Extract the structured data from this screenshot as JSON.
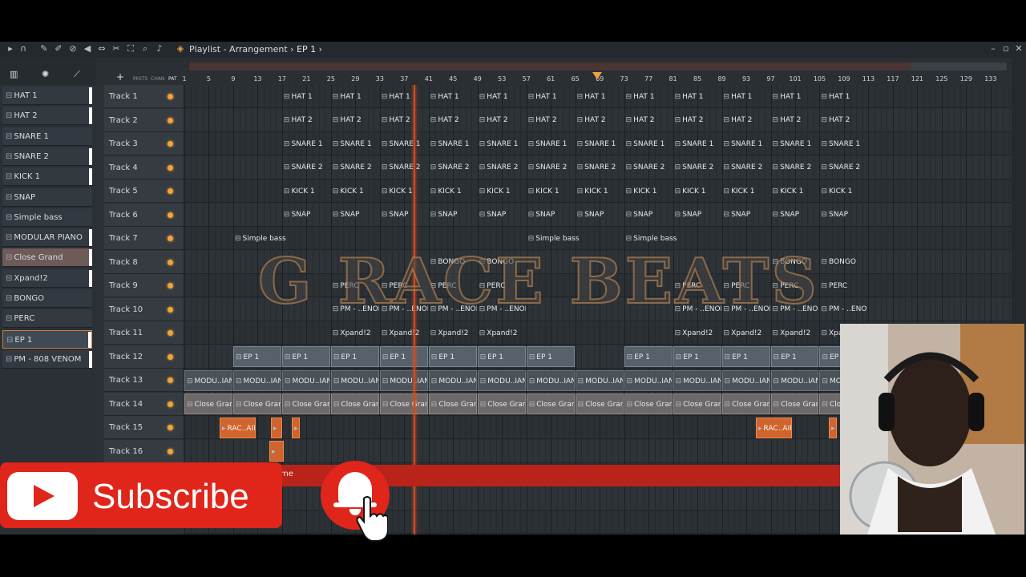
{
  "titlebar": {
    "app_title": "Playlist - Arrangement",
    "separator": "›",
    "pattern": "EP 1",
    "arrow": "›"
  },
  "browser": {
    "patterns": [
      {
        "label": "HAT 1",
        "bar": true
      },
      {
        "label": "HAT 2",
        "bar": true
      },
      {
        "label": "SNARE 1",
        "bar": false
      },
      {
        "label": "SNARE 2",
        "bar": true
      },
      {
        "label": "KICK 1",
        "bar": true
      },
      {
        "label": "SNAP",
        "bar": false
      },
      {
        "label": "Simple bass",
        "bar": false
      },
      {
        "label": "MODULAR PIANO",
        "bar": true
      },
      {
        "label": "Close Grand",
        "bar": true
      },
      {
        "label": "Xpand!2",
        "bar": true
      },
      {
        "label": "BONGO",
        "bar": false
      },
      {
        "label": "PERC",
        "bar": false
      },
      {
        "label": "EP 1",
        "bar": true
      },
      {
        "label": "PM - 808 VENOM",
        "bar": true
      }
    ]
  },
  "header": {
    "add_symbol": "+",
    "small_labels": [
      "MISTS",
      "CHAN",
      "PAT"
    ]
  },
  "tracks": [
    "Track 1",
    "Track 2",
    "Track 3",
    "Track 4",
    "Track 5",
    "Track 6",
    "Track 7",
    "Track 8",
    "Track 9",
    "Track 10",
    "Track 11",
    "Track 12",
    "Track 13",
    "Track 14",
    "Track 15",
    "Track 16"
  ],
  "ruler": {
    "bars": [
      "1",
      "5",
      "9",
      "13",
      "17",
      "21",
      "25",
      "29",
      "33",
      "37",
      "41",
      "45",
      "49",
      "53",
      "57",
      "61",
      "65",
      "69",
      "73",
      "77",
      "81",
      "85",
      "89",
      "93",
      "97",
      "101",
      "105",
      "109",
      "113",
      "117",
      "121",
      "125",
      "129",
      "133"
    ]
  },
  "clips": {
    "hat1": "HAT 1",
    "hat2": "HAT 2",
    "snare1": "SNARE 1",
    "snare2": "SNARE 2",
    "kick1": "KICK 1",
    "snap": "SNAP",
    "bass": "Simple bass",
    "bongo": "BONGO",
    "perc": "PERC",
    "pm": "PM - ..ENOM",
    "xpand": "Xpand!2",
    "ep": "EP 1",
    "modu": "MODU..IANO",
    "cgrand": "Close Grand",
    "rac": "RAC..AIN"
  },
  "watermark": "G RACE BEATS",
  "overlay": {
    "subscribe": "Subscribe",
    "redbar_text": "me"
  }
}
